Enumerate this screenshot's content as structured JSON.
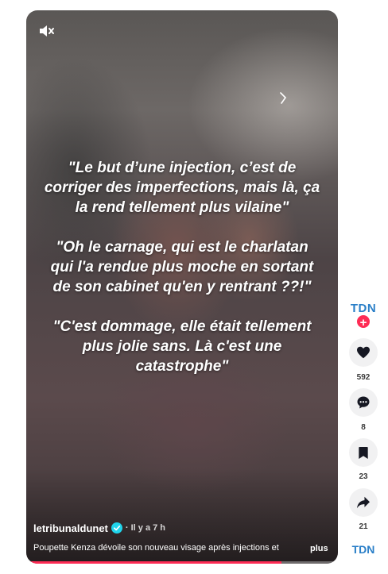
{
  "video": {
    "overlay_quotes": [
      "\"Le but d’une injection, c’est de corriger des imperfections, mais là, ça la rend tellement plus vilaine\"",
      "\"Oh le carnage, qui est le charlatan qui l'a rendue plus moche en sortant de son cabinet qu'en y rentrant ??!\"",
      "\"C'est dommage, elle était tellement plus jolie sans. Là c'est une catastrophe\""
    ],
    "author": "letribunaldunet",
    "time_ago": "· Il y a 7 h",
    "caption": "Poupette Kenza dévoile son nouveau visage après injections et",
    "more_label": "plus",
    "progress": 0.82,
    "mute_icon": "muted-speaker-icon"
  },
  "rail": {
    "avatar_text": "TDN",
    "follow_label": "+",
    "like_count": "592",
    "comment_count": "8",
    "favorite_count": "23",
    "share_count": "21",
    "music_text": "TDN"
  },
  "colors": {
    "accent": "#fe2c55",
    "brand_logo": "#2a7fc8",
    "verified": "#20d5ec"
  }
}
